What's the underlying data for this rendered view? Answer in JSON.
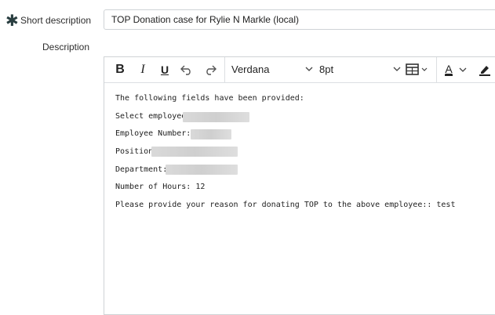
{
  "form": {
    "short_description_label": "Short description",
    "short_description_value": "TOP Donation case for Rylie N Markle (local)",
    "description_label": "Description",
    "required_marker": "✱"
  },
  "toolbar": {
    "bold": "B",
    "italic": "I",
    "underline": "U",
    "font_family": "Verdana",
    "font_size": "8pt",
    "text_color_glyph": "A"
  },
  "content": {
    "lines": [
      "The following fields have been provided:",
      "Select employee:",
      "Employee Number:",
      "Position :",
      "Department:",
      "Number of Hours: 12",
      "Please provide your reason for donating TOP to the above employee:: test"
    ]
  }
}
